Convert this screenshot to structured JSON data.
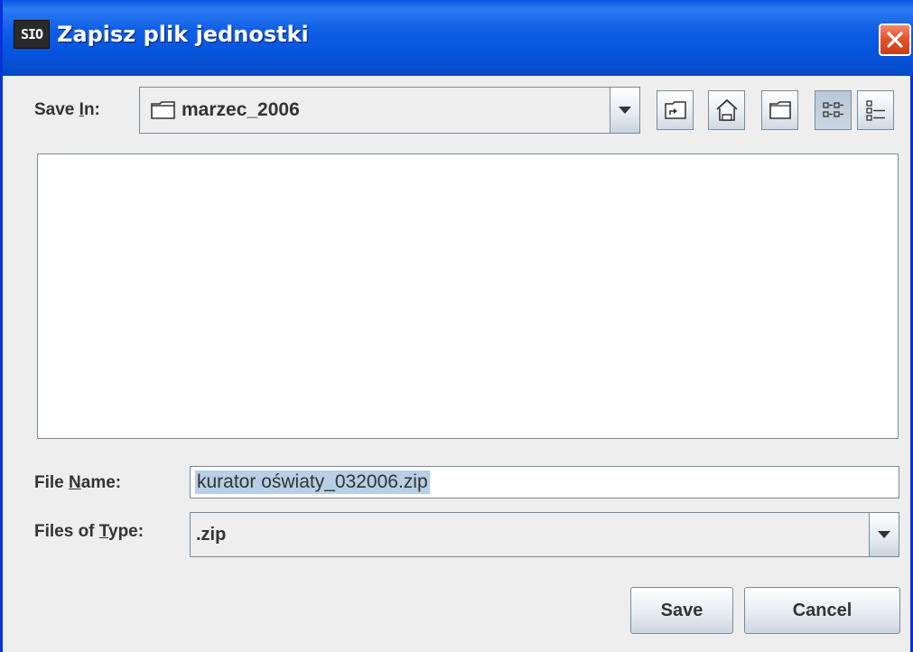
{
  "window": {
    "app_icon_text": "SIO",
    "title": "Zapisz plik jednostki"
  },
  "save_in": {
    "label_prefix": "Save ",
    "label_mnemonic": "I",
    "label_suffix": "n:",
    "value": "marzec_2006",
    "value_icon": "folder-icon"
  },
  "toolbar": {
    "buttons": [
      {
        "name": "up-one-level",
        "icon": "folder-up-icon"
      },
      {
        "name": "home",
        "icon": "home-icon"
      },
      {
        "name": "create-new-folder",
        "icon": "new-folder-icon"
      },
      {
        "name": "list-view",
        "icon": "list-view-icon",
        "pressed": true
      },
      {
        "name": "details-view",
        "icon": "details-view-icon",
        "pressed": false
      }
    ]
  },
  "file_list": {
    "items": []
  },
  "file_name": {
    "label_prefix": "File ",
    "label_mnemonic": "N",
    "label_suffix": "ame:",
    "value": "kurator oświaty_032006.zip"
  },
  "files_of_type": {
    "label_prefix": "Files of ",
    "label_mnemonic": "T",
    "label_suffix": "ype:",
    "value": ".zip"
  },
  "buttons": {
    "save_label": "Save",
    "cancel_label": "Cancel"
  },
  "colors": {
    "titlebar": "#0654dc",
    "close_button": "#e3542c",
    "selection": "#b8cfe5",
    "background": "#eeeeee"
  }
}
